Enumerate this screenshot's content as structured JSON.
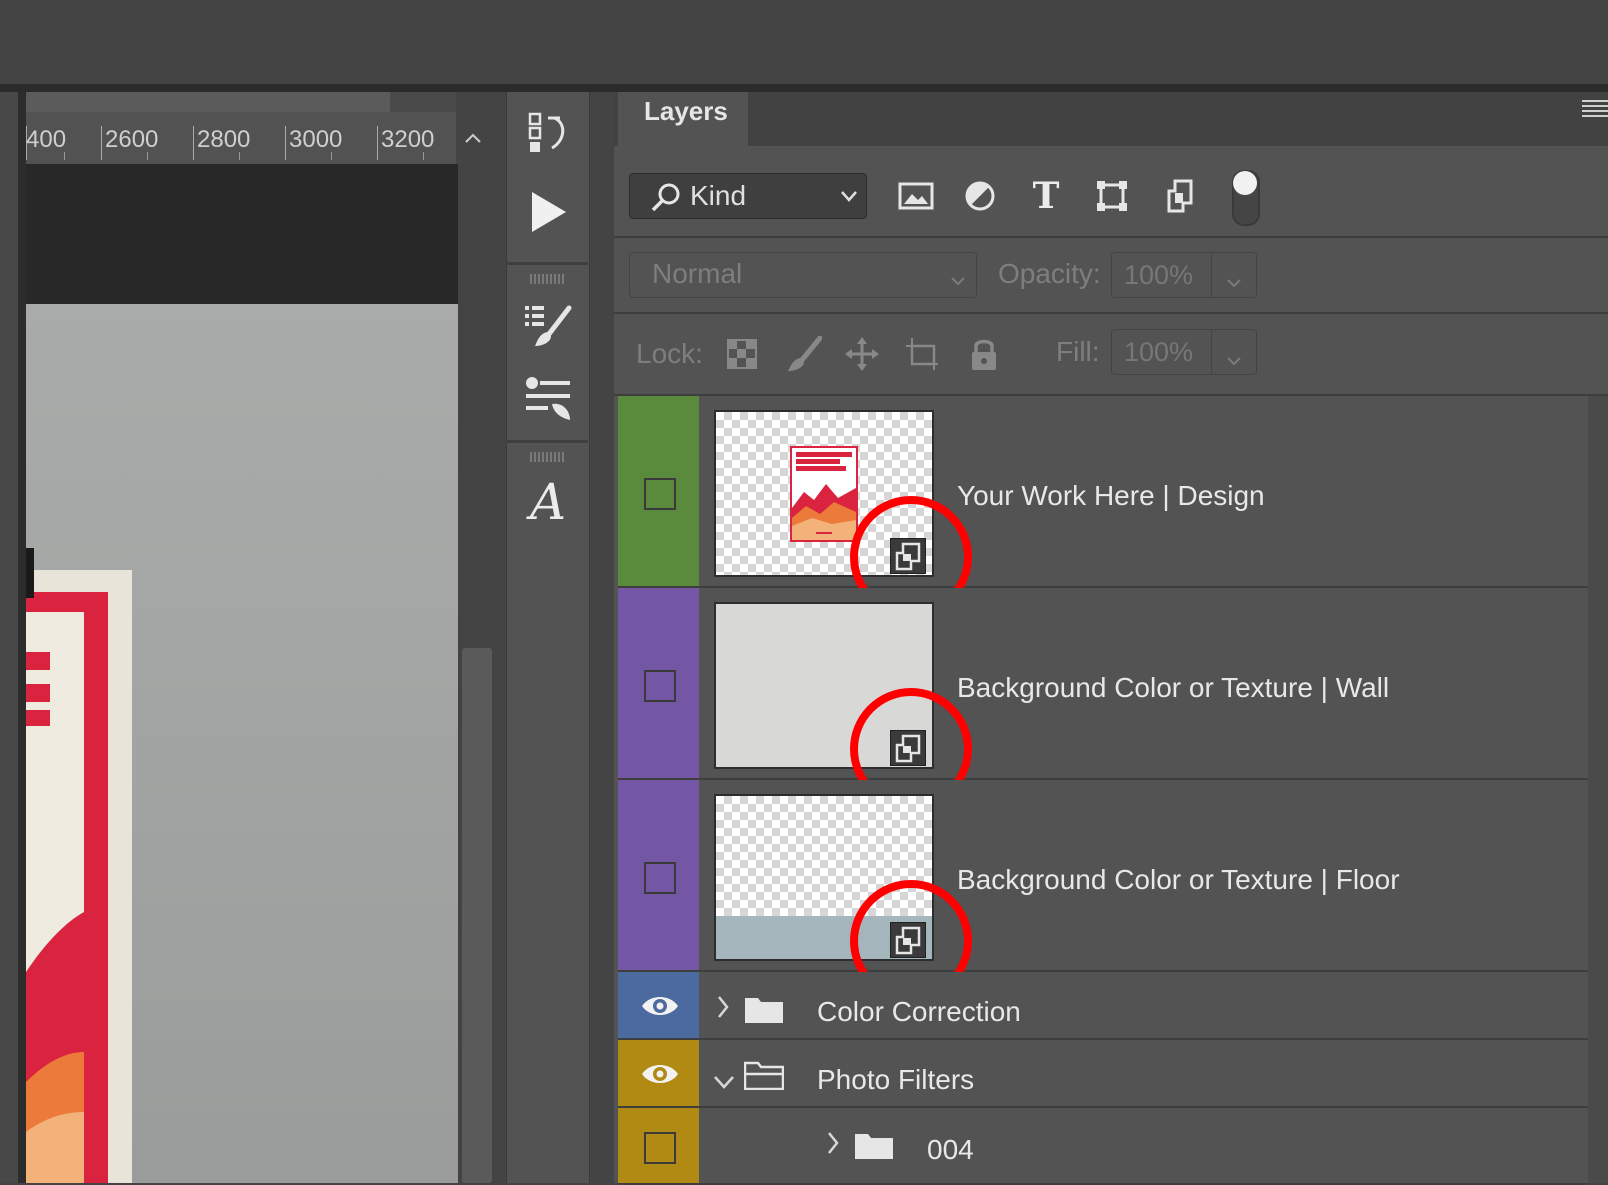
{
  "ruler": {
    "labels": [
      "400",
      "2600",
      "2800",
      "3000",
      "3200"
    ]
  },
  "panel": {
    "tab_label": "Layers"
  },
  "filter": {
    "kind_label": "Kind",
    "icons": [
      "image-filter-icon",
      "adjustment-filter-icon",
      "type-filter-icon",
      "shape-filter-icon",
      "smart-object-filter-icon"
    ]
  },
  "blend": {
    "mode": "Normal",
    "opacity_label": "Opacity:",
    "opacity_value": "100%"
  },
  "lock": {
    "label": "Lock:",
    "fill_label": "Fill:",
    "fill_value": "100%"
  },
  "layers": [
    {
      "name": "Your Work Here | Design",
      "color": "#5a8a3c",
      "visible": false,
      "type": "smart-object"
    },
    {
      "name": "Background Color or Texture | Wall",
      "color": "#7357a4",
      "visible": false,
      "type": "smart-object"
    },
    {
      "name": "Background Color or Texture | Floor",
      "color": "#7357a4",
      "visible": false,
      "type": "smart-object"
    },
    {
      "name": "Color Correction",
      "color": "#4a6aa0",
      "visible": true,
      "type": "group",
      "expanded": false
    },
    {
      "name": "Photo Filters",
      "color": "#b08a12",
      "visible": true,
      "type": "group",
      "expanded": true
    },
    {
      "name": "004",
      "color": "#b08a12",
      "visible": false,
      "type": "group",
      "expanded": false
    }
  ],
  "colors": {
    "highlight_circle": "#ff0000"
  }
}
